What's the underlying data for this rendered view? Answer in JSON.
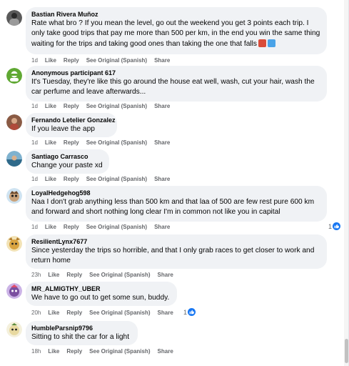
{
  "comments": [
    {
      "author": "Bastian Rivera Muñoz",
      "text": "Rate what bro ? If you mean the level, go out the weekend you get 3 points each trip. I only take good trips that pay me more than 500 per km, in the end you win the same thing waiting for the trips and taking good ones than taking the one that falls",
      "time": "1d",
      "like": "Like",
      "reply": "Reply",
      "see_original": "See Original (Spanish)",
      "share": "Share",
      "avatar_color": "#4a4a4a"
    },
    {
      "author": "Anonymous participant 617",
      "text": "It's Tuesday, they're like this go around the house eat well, wash, cut your hair, wash the car perfume and leave afterwards...",
      "time": "1d",
      "like": "Like",
      "reply": "Reply",
      "see_original": "See Original (Spanish)",
      "share": "Share",
      "avatar_color": "#5fa832"
    },
    {
      "author": "Fernando Letelier Gonzalez",
      "text": "If you leave the app",
      "time": "1d",
      "like": "Like",
      "reply": "Reply",
      "see_original": "See Original (Spanish)",
      "share": "Share",
      "avatar_color": "#8a5a44"
    },
    {
      "author": "Santiago Carrasco",
      "text": "Change your paste xd",
      "time": "1d",
      "like": "Like",
      "reply": "Reply",
      "see_original": "See Original (Spanish)",
      "share": "Share",
      "avatar_color": "#3b6f8f"
    },
    {
      "author": "LoyalHedgehog598",
      "text": "Naa I don't grab anything less than 500 km and that laa of 500 are few rest pure 600 km and forward and short nothing long clear I'm in common not like you in capital",
      "time": "1d",
      "like": "Like",
      "reply": "Reply",
      "see_original": "See Original (Spanish)",
      "share": "Share",
      "reaction_count": "1",
      "avatar_color": "#e8c7a0"
    },
    {
      "author": "ResilientLynx7677",
      "text": "Since yesterday the trips so horrible, and that I only grab races to get closer to work and return home",
      "time": "23h",
      "like": "Like",
      "reply": "Reply",
      "see_original": "See Original (Spanish)",
      "share": "Share",
      "avatar_color": "#d9a441"
    },
    {
      "author": "MR_ALMIGTHY_UBER",
      "text": "We have to go out to get some sun, buddy.",
      "time": "20h",
      "like": "Like",
      "reply": "Reply",
      "see_original": "See Original (Spanish)",
      "share": "Share",
      "reaction_count": "1",
      "avatar_color": "#7b4fa0"
    },
    {
      "author": "HumbleParsnip9796",
      "text": "Sitting to shit the car for a light",
      "time": "18h",
      "like": "Like",
      "reply": "Reply",
      "see_original": "See Original (Spanish)",
      "share": "Share",
      "avatar_color": "#e8d9a0"
    }
  ]
}
